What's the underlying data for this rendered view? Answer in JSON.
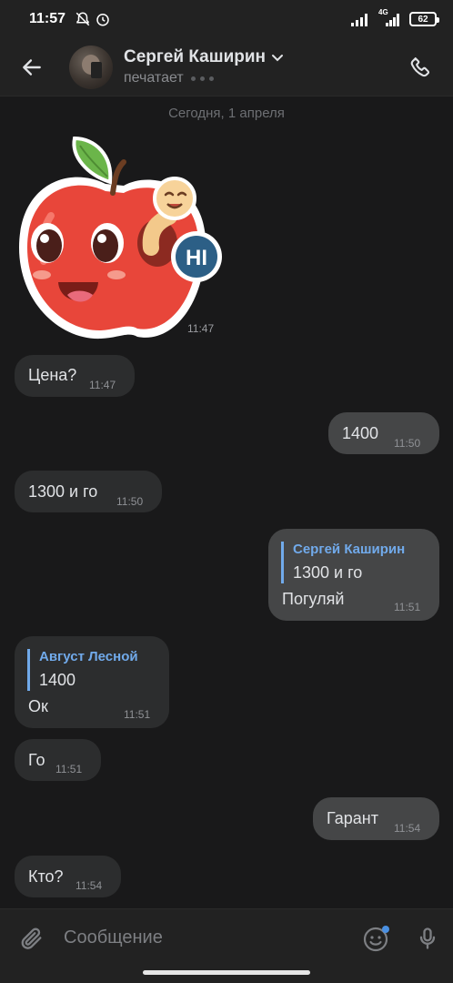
{
  "status_bar": {
    "time": "11:57",
    "battery": "62",
    "network": "4G"
  },
  "header": {
    "contact_name": "Сергей Каширин",
    "status": "печатает"
  },
  "chat": {
    "date_separator": "Сегодня, 1 апреля",
    "sticker": {
      "text": "HI",
      "time": "11:47"
    },
    "messages": [
      {
        "dir": "in",
        "text": "Цена?",
        "time": "11:47"
      },
      {
        "dir": "out",
        "text": "1400",
        "time": "11:50"
      },
      {
        "dir": "in",
        "text": "1300 и го",
        "time": "11:50"
      },
      {
        "dir": "out",
        "reply_name": "Сергей Каширин",
        "reply_text": "1300 и го",
        "text": "Погуляй",
        "time": "11:51"
      },
      {
        "dir": "in",
        "reply_name": "Август Лесной",
        "reply_text": "1400",
        "text": "Ок",
        "time": "11:51"
      },
      {
        "dir": "in",
        "text": "Го",
        "time": "11:51"
      },
      {
        "dir": "out",
        "text": "Гарант",
        "time": "11:54"
      },
      {
        "dir": "in",
        "text": "Кто?",
        "time": "11:54"
      }
    ]
  },
  "input": {
    "placeholder": "Сообщение"
  },
  "colors": {
    "accent": "#71aaeb",
    "background": "#19191a",
    "incoming_bubble": "#2c2d2e",
    "outgoing_bubble": "#454647"
  }
}
